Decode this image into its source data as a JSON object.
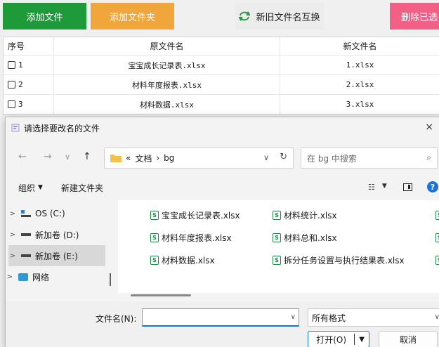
{
  "toolbar": {
    "add_file": "添加文件",
    "add_folder": "添加文件夹",
    "swap_names": "新旧文件名互换",
    "delete_selected": "删除已选",
    "colors": {
      "add_file": "#1f9a3b",
      "add_folder": "#f0a63a",
      "delete": "#f45f86"
    }
  },
  "table": {
    "headers": {
      "index": "序号",
      "old_name": "原文件名",
      "new_name": "新文件名"
    },
    "rows": [
      {
        "index": "1",
        "old_name": "宝宝成长记录表.xlsx",
        "new_name": "1.xlsx"
      },
      {
        "index": "2",
        "old_name": "材料年度报表.xlsx",
        "new_name": "2.xlsx"
      },
      {
        "index": "3",
        "old_name": "材料数据.xlsx",
        "new_name": "3.xlsx"
      }
    ]
  },
  "dialog": {
    "title": "请选择要改名的文件",
    "close": "×",
    "nav": {
      "back": "←",
      "forward": "→",
      "recent": "∨",
      "up": "↑"
    },
    "address": {
      "prefix": "«",
      "segment1": "文档",
      "sep": "›",
      "segment2": "bg"
    },
    "search_placeholder": "在 bg 中搜索",
    "commands": {
      "organize": "组织",
      "new_folder": "新建文件夹"
    },
    "sidebar": [
      {
        "label": "OS (C:)",
        "icon": "os-drive-icon"
      },
      {
        "label": "新加卷 (D:)",
        "icon": "drive-icon"
      },
      {
        "label": "新加卷 (E:)",
        "icon": "drive-icon",
        "selected": true
      },
      {
        "label": "网络",
        "icon": "network-icon"
      }
    ],
    "files": [
      "宝宝成长记录表.xlsx",
      "材料年度报表.xlsx",
      "材料数据.xlsx",
      "材料统计.xlsx",
      "材料总和.xlsx",
      "拆分任务设置与执行结果表.xlsx"
    ],
    "filename_label": "文件名(N):",
    "filename_value": "",
    "format_value": "所有格式",
    "open_label": "打开(O)",
    "cancel_label": "取消"
  }
}
